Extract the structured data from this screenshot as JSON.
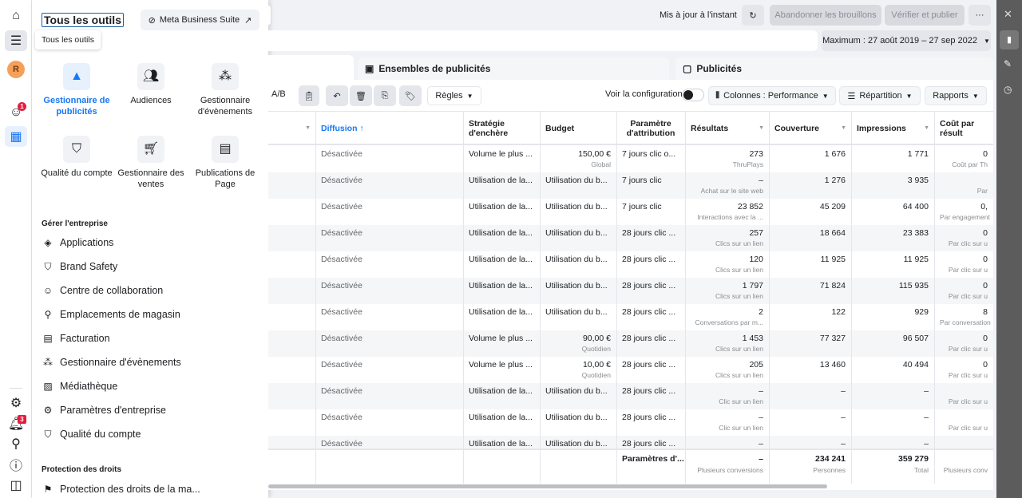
{
  "rail": {
    "avatar": "R",
    "notif_badge": "1",
    "bell_badge": "3",
    "icons": [
      "home-icon",
      "menu-icon",
      "avatar",
      "emoji-notification-icon",
      "ads-table-icon",
      "gear-icon",
      "bell-icon",
      "search-icon",
      "help-icon",
      "panel-toggle-icon"
    ]
  },
  "panel": {
    "title": "Tous les outils",
    "tooltip": "Tous les outils",
    "mbs_label": "Meta Business Suite",
    "tools": [
      {
        "label": "Gestionnaire de publicités",
        "icon": "ads-manager-icon",
        "active": true
      },
      {
        "label": "Audiences",
        "icon": "people-icon"
      },
      {
        "label": "Gestionnaire d'évènements",
        "icon": "events-icon"
      },
      {
        "label": "Qualité du compte",
        "icon": "shield-icon"
      },
      {
        "label": "Gestionnaire des ventes",
        "icon": "cart-icon"
      },
      {
        "label": "Publications de Page",
        "icon": "page-posts-icon"
      }
    ],
    "section1": "Gérer l'entreprise",
    "items": [
      {
        "label": "Applications",
        "icon": "cube-icon"
      },
      {
        "label": "Brand Safety",
        "icon": "shield-icon"
      },
      {
        "label": "Centre de collaboration",
        "icon": "handshake-icon"
      },
      {
        "label": "Emplacements de magasin",
        "icon": "location-icon"
      },
      {
        "label": "Facturation",
        "icon": "billing-icon"
      },
      {
        "label": "Gestionnaire d'évènements",
        "icon": "events-icon"
      },
      {
        "label": "Médiathèque",
        "icon": "image-icon"
      },
      {
        "label": "Paramètres d'entreprise",
        "icon": "gear-icon"
      },
      {
        "label": "Qualité du compte",
        "icon": "shield-icon"
      }
    ],
    "section2": "Protection des droits",
    "items2": [
      {
        "label": "Protection des droits de la ma...",
        "icon": "flag-icon"
      }
    ]
  },
  "topbar": {
    "status": "Mis à jour à l'instant",
    "discard": "Abandonner les brouillons",
    "publish": "Vérifier et publier",
    "more": "···",
    "date_range": "Maximum : 27 août 2019 – 27 sep 2022"
  },
  "tabs": [
    {
      "label": "Ensembles de publicités",
      "icon": "grid-icon"
    },
    {
      "label": "Publicités",
      "icon": "ad-icon"
    }
  ],
  "toolbar": {
    "ab": "A/B",
    "rules": "Règles",
    "view_config": "Voir la configuration",
    "columns": "Colonnes : Performance",
    "breakdown": "Répartition",
    "reports": "Rapports"
  },
  "colors": {
    "accent": "#1877f2",
    "rail_dark": "#5c5c5c"
  },
  "table": {
    "headers": [
      "",
      "Diffusion ↑",
      "Stratégie d'enchère",
      "Budget",
      "Paramètre d'attribution",
      "Résultats",
      "Couverture",
      "Impressions",
      "Coût par résult"
    ],
    "rows": [
      [
        "Désactivée",
        "Volume le plus ...",
        "150,00 €",
        "Global",
        "7 jours clic o...",
        "273",
        "ThruPlays",
        "1 676",
        "1 771",
        "0",
        "Coût par Th"
      ],
      [
        "Désactivée",
        "Utilisation de la...",
        "Utilisation du b...",
        "",
        "7 jours clic",
        "–",
        "Achat sur le site web",
        "1 276",
        "3 935",
        "",
        "Par"
      ],
      [
        "Désactivée",
        "Utilisation de la...",
        "Utilisation du b...",
        "",
        "7 jours clic",
        "23 852",
        "Interactions avec la ...",
        "45 209",
        "64 400",
        "0,",
        "Par engagement"
      ],
      [
        "Désactivée",
        "Utilisation de la...",
        "Utilisation du b...",
        "",
        "28 jours clic ...",
        "257",
        "Clics sur un lien",
        "18 664",
        "23 383",
        "0",
        "Par clic sur u"
      ],
      [
        "Désactivée",
        "Utilisation de la...",
        "Utilisation du b...",
        "",
        "28 jours clic ...",
        "120",
        "Clics sur un lien",
        "11 925",
        "11 925",
        "0",
        "Par clic sur u"
      ],
      [
        "Désactivée",
        "Utilisation de la...",
        "Utilisation du b...",
        "",
        "28 jours clic ...",
        "1 797",
        "Clics sur un lien",
        "71 824",
        "115 935",
        "0",
        "Par clic sur u"
      ],
      [
        "Désactivée",
        "Utilisation de la...",
        "Utilisation du b...",
        "",
        "28 jours clic ...",
        "2",
        "Conversations par m...",
        "122",
        "929",
        "8",
        "Par conversation"
      ],
      [
        "Désactivée",
        "Volume le plus ...",
        "90,00 €",
        "Quotidien",
        "28 jours clic ...",
        "1 453",
        "Clics sur un lien",
        "77 327",
        "96 507",
        "0",
        "Par clic sur u"
      ],
      [
        "Désactivée",
        "Volume le plus ...",
        "10,00 €",
        "Quotidien",
        "28 jours clic ...",
        "205",
        "Clics sur un lien",
        "13 460",
        "40 494",
        "0",
        "Par clic sur u"
      ],
      [
        "Désactivée",
        "Utilisation de la...",
        "Utilisation du b...",
        "",
        "28 jours clic ...",
        "–",
        "Clic sur un lien",
        "–",
        "–",
        "",
        "Par clic sur u"
      ],
      [
        "Désactivée",
        "Utilisation de la...",
        "Utilisation du b...",
        "",
        "28 jours clic ...",
        "–",
        "Clic sur un lien",
        "–",
        "–",
        "",
        "Par clic sur u"
      ],
      [
        "Désactivée",
        "Utilisation de la...",
        "Utilisation du b...",
        "",
        "28 jours clic ...",
        "–",
        "",
        "–",
        "–",
        "",
        ""
      ]
    ],
    "totals": {
      "attribution": "Paramètres d'...",
      "results": "–",
      "results_sub": "Plusieurs conversions",
      "reach": "234 241",
      "reach_sub": "Personnes",
      "impressions": "359 279",
      "impressions_sub": "Total",
      "cost_sub": "Plusieurs conv"
    }
  }
}
